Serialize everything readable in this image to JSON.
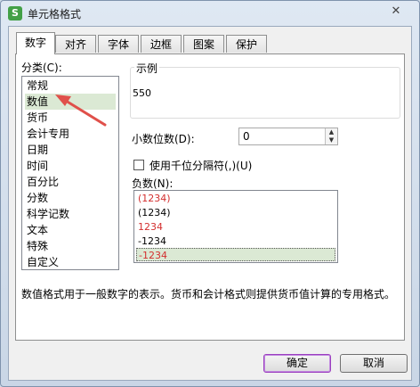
{
  "window": {
    "title": "单元格格式",
    "app_icon": "S",
    "close_glyph": "✕"
  },
  "tabs": [
    {
      "label": "数字",
      "active": true
    },
    {
      "label": "对齐",
      "active": false
    },
    {
      "label": "字体",
      "active": false
    },
    {
      "label": "边框",
      "active": false
    },
    {
      "label": "图案",
      "active": false
    },
    {
      "label": "保护",
      "active": false
    }
  ],
  "category": {
    "label": "分类(C):",
    "items": [
      "常规",
      "数值",
      "货币",
      "会计专用",
      "日期",
      "时间",
      "百分比",
      "分数",
      "科学记数",
      "文本",
      "特殊",
      "自定义"
    ],
    "selected_index": 1
  },
  "sample": {
    "label": "示例",
    "value": "550"
  },
  "decimal": {
    "label": "小数位数(D):",
    "value": "0"
  },
  "separator": {
    "label": "使用千位分隔符(,)(U)",
    "checked": false
  },
  "negative": {
    "label": "负数(N):",
    "items": [
      {
        "text": "(1234)",
        "color": "#d32f2f"
      },
      {
        "text": "(1234)",
        "color": "#000000"
      },
      {
        "text": "1234",
        "color": "#d32f2f"
      },
      {
        "text": "-1234",
        "color": "#000000"
      },
      {
        "text": "-1234",
        "color": "#d32f2f"
      }
    ],
    "selected_index": 4
  },
  "description": "数值格式用于一般数字的表示。货币和会计格式则提供货币值计算的专用格式。",
  "buttons": {
    "ok": "确定",
    "cancel": "取消"
  },
  "colors": {
    "accent_arrow": "#e0504a",
    "selection": "#dbe9d4"
  }
}
